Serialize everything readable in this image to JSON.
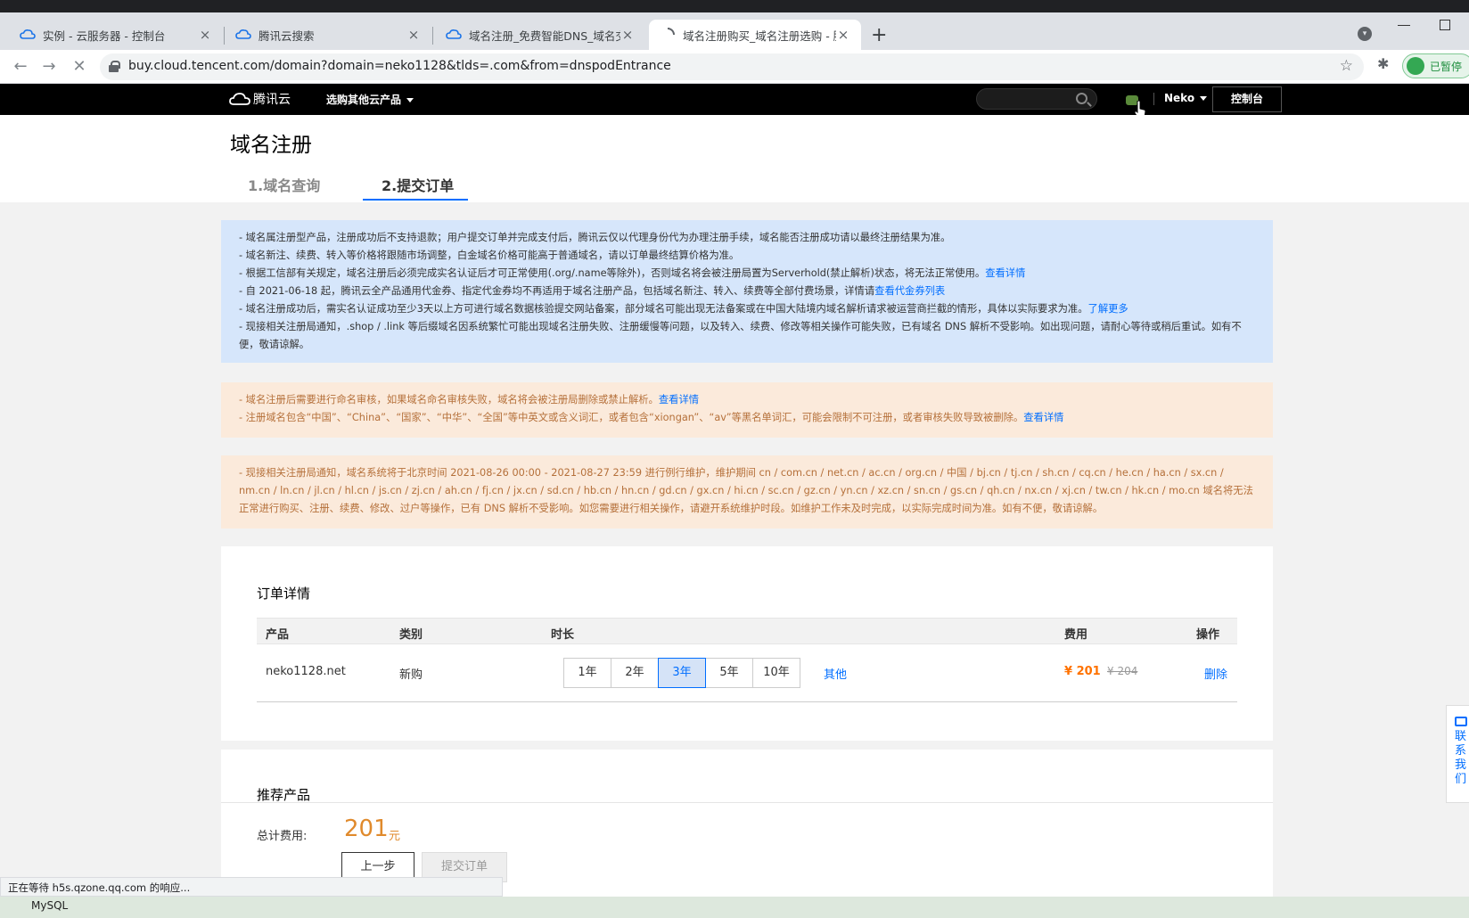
{
  "browser": {
    "tabs": [
      {
        "title": "实例 - 云服务器 - 控制台"
      },
      {
        "title": "腾讯云搜索"
      },
      {
        "title": "域名注册_免费智能DNS_域名交易"
      },
      {
        "title": "域名注册购买_域名注册选购 - 腾"
      }
    ],
    "close_glyph": "×",
    "new_tab": "+",
    "url": "buy.cloud.tencent.com/domain?domain=neko1128&tlds=.com&from=dnspodEntrance",
    "profile_label": "已暂停",
    "status_text": "正在等待 h5s.qzone.qq.com 的响应..."
  },
  "header": {
    "logo_text": "腾讯云",
    "products_menu": "选购其他云产品",
    "user": "Neko",
    "console_label": "控制台"
  },
  "page": {
    "title": "域名注册",
    "steps": [
      "1.域名查询",
      "2.提交订单"
    ]
  },
  "notices": {
    "blue": [
      {
        "text": "- 域名属注册型产品，注册成功后不支持退款；用户提交订单并完成支付后，腾讯云仅以代理身份代为办理注册手续，域名能否注册成功请以最终注册结果为准。",
        "link": ""
      },
      {
        "text": "- 域名新注、续费、转入等价格将跟随市场调整，白金域名价格可能高于普通域名，请以订单最终结算价格为准。",
        "link": ""
      },
      {
        "text": "- 根据工信部有关规定，域名注册后必须完成实名认证后才可正常使用(.org/.name等除外)，否则域名将会被注册局置为Serverhold(禁止解析)状态，将无法正常使用。",
        "link": "查看详情"
      },
      {
        "text": "- 自 2021-06-18 起，腾讯云全产品通用代金券、指定代金券均不再适用于域名注册产品，包括域名新注、转入、续费等全部付费场景，详情请",
        "link": "查看代金券列表"
      },
      {
        "text": "- 域名注册成功后，需实名认证成功至少3天以上方可进行域名数据核验提交网站备案，部分域名可能出现无法备案或在中国大陆境内域名解析请求被运营商拦截的情形，具体以实际要求为准。",
        "link": "了解更多"
      }
    ],
    "blue_last": "- 现接相关注册局通知，.shop / .link 等后缀域名因系统繁忙可能出现域名注册失败、注册缓慢等问题，以及转入、续费、修改等相关操作可能失败，已有域名 DNS 解析不受影响。如出现问题，请耐心等待或稍后重试。如有不便，敬请谅解。",
    "orange1": [
      {
        "text": "- 域名注册后需要进行命名审核，如果域名命名审核失败，域名将会被注册局删除或禁止解析。",
        "link": "查看详情"
      },
      {
        "text": "- 注册域名包含“中国”、“China”、“国家”、“中华”、“全国”等中英文或含义词汇，或者包含“xiongan”、“av”等黑名单词汇，可能会限制不可注册，或者审核失败导致被删除。",
        "link": "查看详情"
      }
    ],
    "orange2": "- 现接相关注册局通知，域名系统将于北京时间 2021-08-26 00:00 - 2021-08-27 23:59 进行例行维护，维护期间 cn / com.cn / net.cn / ac.cn / org.cn / 中国 / bj.cn / tj.cn / sh.cn / cq.cn / he.cn / ha.cn / sx.cn / nm.cn / ln.cn / jl.cn / hl.cn / js.cn / zj.cn / ah.cn / fj.cn / jx.cn / sd.cn / hb.cn / hn.cn / gd.cn / gx.cn / hi.cn / sc.cn / gz.cn / yn.cn / xz.cn / sn.cn / gs.cn / qh.cn / nx.cn / xj.cn / tw.cn / hk.cn / mo.cn 域名将无法正常进行购买、注册、续费、修改、过户等操作，已有 DNS 解析不受影响。如您需要进行相关操作，请避开系统维护时段。如维护工作未及时完成，以实际完成时间为准。如有不便，敬请谅解。"
  },
  "order": {
    "title": "订单详情",
    "columns": [
      "产品",
      "类别",
      "时长",
      "费用",
      "操作"
    ],
    "row": {
      "product": "neko1128.net",
      "category": "新购",
      "durations": [
        "1年",
        "2年",
        "3年",
        "5年",
        "10年"
      ],
      "selected_duration": "3年",
      "other": "其他",
      "price": "¥ 201",
      "original_price": "¥ 204",
      "action": "删除"
    }
  },
  "recommend": {
    "title": "推荐产品"
  },
  "footer": {
    "total_label": "总计费用:",
    "total_value": "201",
    "total_unit": "元",
    "prev_label": "上一步",
    "submit_label": "提交订单"
  },
  "contact": {
    "label": "联系我们"
  },
  "taskbar": {
    "label": "MySQL"
  },
  "colors": {
    "accent": "#006eff",
    "price": "#ff7200",
    "notice_blue": "#d6e6fb",
    "notice_orange": "#fbeadb"
  }
}
